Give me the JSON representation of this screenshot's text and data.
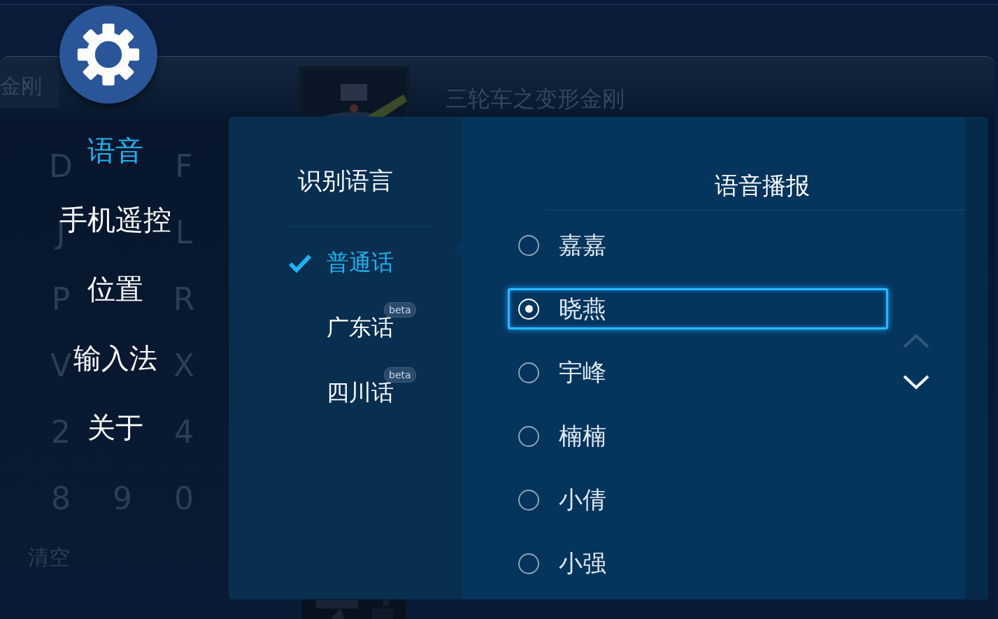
{
  "background": {
    "search_text": "金刚",
    "title": "三轮车之变形金刚",
    "clear_key": "清空",
    "key_rows": [
      {
        "keys": [
          "D",
          "F"
        ]
      },
      {
        "keys": [
          "J",
          "L"
        ]
      },
      {
        "keys": [
          "P",
          "R"
        ]
      },
      {
        "keys": [
          "V",
          "X"
        ]
      },
      {
        "keys": [
          "2",
          "4"
        ]
      },
      {
        "keys": [
          "8",
          "9",
          "0"
        ]
      }
    ]
  },
  "menu": [
    {
      "label": "语音",
      "selected": true
    },
    {
      "label": "手机遥控",
      "selected": false
    },
    {
      "label": "位置",
      "selected": false
    },
    {
      "label": "输入法",
      "selected": false
    },
    {
      "label": "关于",
      "selected": false
    }
  ],
  "recognition": {
    "title": "识别语言",
    "options": [
      {
        "label": "普通话",
        "selected": true
      },
      {
        "label": "广东话",
        "selected": false,
        "badge": "beta"
      },
      {
        "label": "四川话",
        "selected": false,
        "badge": "beta"
      }
    ]
  },
  "voice": {
    "title": "语音播报",
    "scroll_up": {
      "disabled": true
    },
    "scroll_down": {
      "disabled": false
    },
    "options": [
      {
        "label": "嘉嘉",
        "selected": false,
        "focused": false
      },
      {
        "label": "晓燕",
        "selected": true,
        "focused": true
      },
      {
        "label": "宇峰",
        "selected": false,
        "focused": false
      },
      {
        "label": "楠楠",
        "selected": false,
        "focused": false
      },
      {
        "label": "小倩",
        "selected": false,
        "focused": false
      },
      {
        "label": "小强",
        "selected": false,
        "focused": false
      }
    ]
  }
}
